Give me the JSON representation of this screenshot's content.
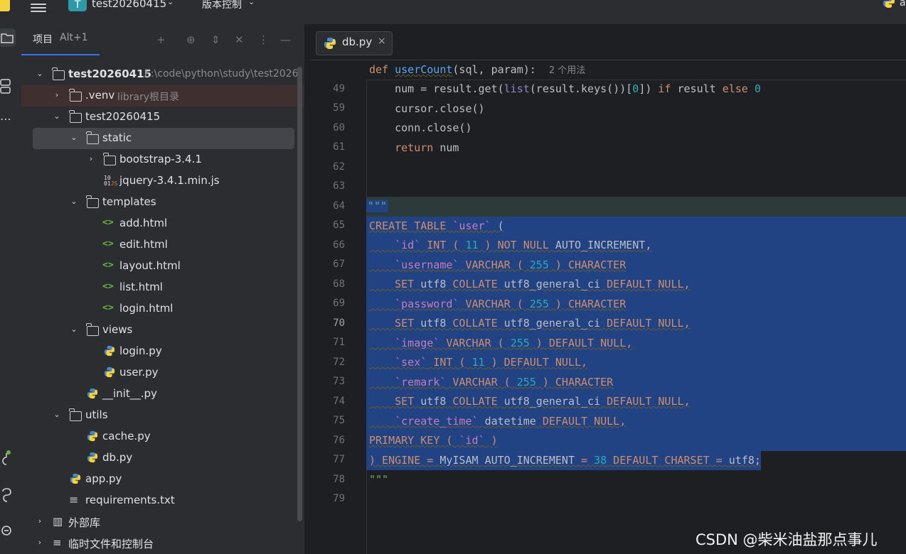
{
  "titlebar": {
    "project_badge": "T",
    "project_name": "test20260415",
    "vcs_label": "版本控制",
    "right_text": "a"
  },
  "project_panel": {
    "tab_label": "项目",
    "tab_shortcut": "Alt+1",
    "tree": [
      {
        "label": "test20260415",
        "hint": "E:\\code\\python\\study\\test2026"
      },
      {
        "label": ".venv",
        "hint": "library根目录"
      },
      {
        "label": "test20260415"
      },
      {
        "label": "static"
      },
      {
        "label": "bootstrap-3.4.1"
      },
      {
        "label": "jquery-3.4.1.min.js",
        "icon_top": "10",
        "icon_bottom": "01",
        "icon_js": "JS"
      },
      {
        "label": "templates"
      },
      {
        "label": "add.html"
      },
      {
        "label": "edit.html"
      },
      {
        "label": "layout.html"
      },
      {
        "label": "list.html"
      },
      {
        "label": "login.html"
      },
      {
        "label": "views"
      },
      {
        "label": "login.py"
      },
      {
        "label": "user.py"
      },
      {
        "label": "__init__.py"
      },
      {
        "label": "utils"
      },
      {
        "label": "cache.py"
      },
      {
        "label": "db.py"
      },
      {
        "label": "app.py"
      },
      {
        "label": "requirements.txt"
      },
      {
        "label": "外部库"
      },
      {
        "label": "临时文件和控制台"
      }
    ]
  },
  "editor": {
    "tab_label": "db.py",
    "tab_close": "×",
    "sticky": {
      "line": "49",
      "kw": "def",
      "fn": "userCount",
      "rest": "(sql, param):",
      "inlay": "2 个用法"
    },
    "lines": [
      {
        "n": "59"
      },
      {
        "n": "60"
      },
      {
        "n": "61"
      },
      {
        "n": "62"
      },
      {
        "n": "63"
      },
      {
        "n": "64"
      },
      {
        "n": "65"
      },
      {
        "n": "66"
      },
      {
        "n": "67"
      },
      {
        "n": "68"
      },
      {
        "n": "69"
      },
      {
        "n": "70"
      },
      {
        "n": "71"
      },
      {
        "n": "72"
      },
      {
        "n": "73"
      },
      {
        "n": "74"
      },
      {
        "n": "75"
      },
      {
        "n": "76"
      },
      {
        "n": "77"
      },
      {
        "n": "78"
      },
      {
        "n": "79"
      }
    ],
    "code": {
      "l59": {
        "a": "    num = result.get(",
        "b": "list",
        "c": "(result.keys())[",
        "d": "0",
        "e": "]) ",
        "f": "if",
        "g": " result ",
        "h": "else",
        "i": " ",
        "j": "0"
      },
      "l60": "    cursor.close()",
      "l61": "    conn.close()",
      "l62": {
        "kw": "    return",
        "rest": " num"
      },
      "l65": "\"\"\"",
      "l66": {
        "a": "CREATE TABLE ",
        "b": "`user`",
        "c": " ("
      },
      "l67": {
        "a": "    ",
        "b": "`id`",
        "c": " INT ( ",
        "d": "11",
        "e": " ) NOT NULL ",
        "f": "AUTO_INCREMENT,"
      },
      "l68": {
        "a": "    ",
        "b": "`username`",
        "c": " VARCHAR ( ",
        "d": "255",
        "e": " ) CHARACTER"
      },
      "l69": {
        "a": "    SET ",
        "b": "utf8",
        "c": " COLLATE ",
        "d": "utf8_general_ci",
        "e": " DEFAULT NULL,"
      },
      "l70": {
        "a": "    ",
        "b": "`password`",
        "c": " VARCHAR ( ",
        "d": "255",
        "e": " ) CHARACTER"
      },
      "l71": {
        "a": "    SET ",
        "b": "utf8",
        "c": " COLLATE ",
        "d": "utf8_general_ci",
        "e": " DEFAULT NULL,"
      },
      "l72": {
        "a": "    ",
        "b": "`image`",
        "c": " VARCHAR ( ",
        "d": "255",
        "e": " ) DEFAULT NULL,"
      },
      "l73": {
        "a": "    ",
        "b": "`sex`",
        "c": " INT ( ",
        "d": "11",
        "e": " ) DEFAULT NULL,"
      },
      "l74": {
        "a": "    ",
        "b": "`remark`",
        "c": " VARCHAR ( ",
        "d": "255",
        "e": " ) CHARACTER"
      },
      "l75": {
        "a": "    SET ",
        "b": "utf8",
        "c": " COLLATE ",
        "d": "utf8_general_ci",
        "e": " DEFAULT NULL,"
      },
      "l76": {
        "a": "    ",
        "b": "`create_time`",
        "c": " ",
        "d": "datetime",
        "e": " DEFAULT NULL,"
      },
      "l77": {
        "a": "PRIMARY KEY ( ",
        "b": "`id`",
        "c": " )"
      },
      "l78": {
        "a": ") ENGINE = ",
        "b": "MyISAM",
        "c": " ",
        "d": "AUTO_INCREMENT",
        "e": " = ",
        "f": "38",
        "g": " DEFAULT CHARSET = ",
        "h": "utf8",
        "i": ";"
      },
      "l79": "\"\"\""
    }
  },
  "watermark": "CSDN @柴米油盐那点事儿",
  "colors": {
    "selection": "#214283",
    "accent": "#3574f0",
    "keyword": "#cf8e6d",
    "function": "#56a8f5",
    "number": "#2aacb8"
  }
}
